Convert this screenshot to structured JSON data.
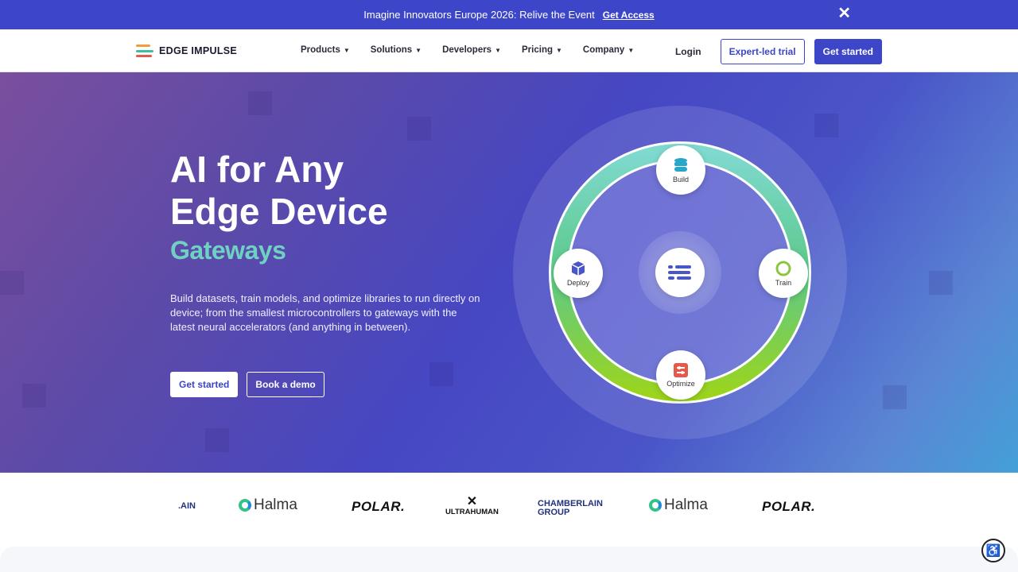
{
  "announcement": {
    "text": "Imagine Innovators Europe 2026: Relive the Event",
    "link": "Get Access",
    "close": "✕"
  },
  "brand": {
    "name": "EDGE IMPULSE"
  },
  "nav": {
    "items": [
      {
        "label": "Products"
      },
      {
        "label": "Solutions"
      },
      {
        "label": "Developers"
      },
      {
        "label": "Pricing"
      },
      {
        "label": "Company"
      }
    ],
    "login": "Login",
    "trial": "Expert-led trial",
    "cta": "Get started"
  },
  "hero": {
    "title_line1": "AI for Any",
    "title_line2": "Edge Device",
    "rotating_word": "Gateways",
    "description": "Build datasets, train models, and optimize libraries to run directly on device; from the smallest microcontrollers to gateways with the latest neural accelerators (and anything in between).",
    "primary_btn": "Get started",
    "secondary_btn": "Book a demo"
  },
  "cycle": {
    "build": "Build",
    "train": "Train",
    "optimize": "Optimize",
    "deploy": "Deploy"
  },
  "logos": {
    "partial": ".AIN",
    "halma": "Halma",
    "polar": "POLAR.",
    "ultrahuman": "ULTRAHUMAN",
    "chamberlain_1": "CHAMBERLAIN",
    "chamberlain_2": "GROUP"
  },
  "colors": {
    "accent": "#3d45c8",
    "teal": "#6fd1c2",
    "green": "#8cd23a"
  }
}
